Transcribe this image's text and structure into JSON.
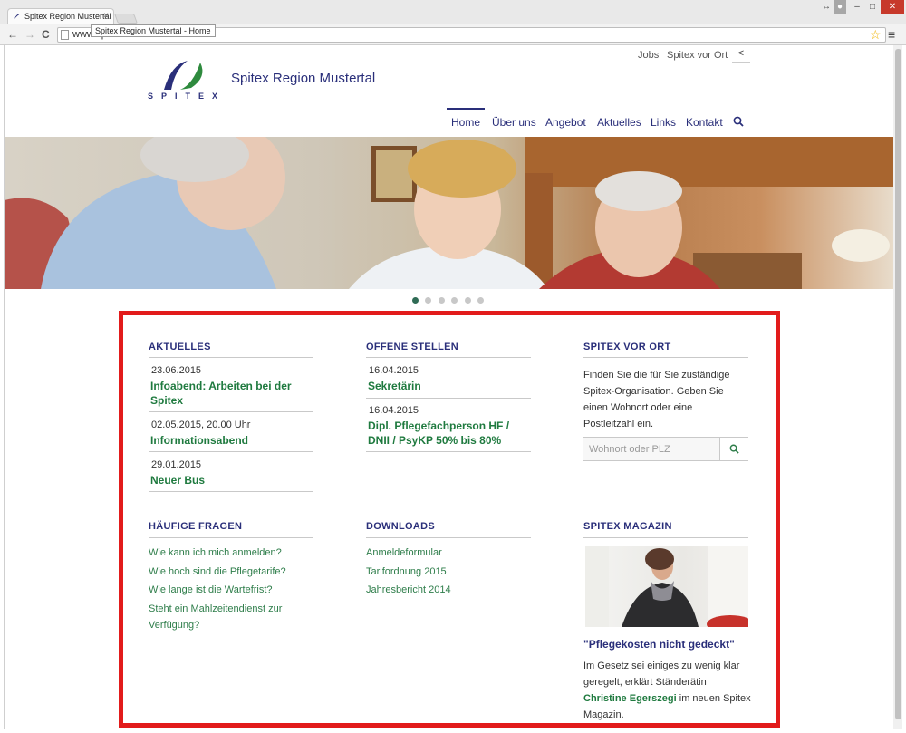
{
  "browser": {
    "tab_title": "Spitex Region Mustertal -",
    "tab_close": "×",
    "tooltip": "Spitex Region Mustertal - Home",
    "url": "www.spitex-website.ch",
    "back": "←",
    "forward": "→",
    "reload": "C",
    "star": "☆",
    "menu": "≡",
    "win_controls": [
      "↔",
      "–",
      "□",
      "✕"
    ]
  },
  "header": {
    "logo_text": "SPITEX",
    "site_title": "Spitex Region Mustertal",
    "top_links": [
      "Jobs",
      "Spitex vor Ort"
    ],
    "share_icon": "share-icon"
  },
  "nav": {
    "items": [
      "Home",
      "Über uns",
      "Angebot",
      "Aktuelles",
      "Links",
      "Kontakt"
    ],
    "active": "Home"
  },
  "carousel": {
    "count": 6,
    "active_index": 0
  },
  "aktuelles": {
    "title": "AKTUELLES",
    "items": [
      {
        "date": "23.06.2015",
        "title_lines": [
          "Infoabend: Arbeiten bei der",
          "Spitex"
        ]
      },
      {
        "date": "02.05.2015, 20.00 Uhr",
        "title_lines": [
          "Informationsabend"
        ]
      },
      {
        "date": "29.01.2015",
        "title_lines": [
          "Neuer Bus"
        ]
      }
    ]
  },
  "offene_stellen": {
    "title": "OFFENE STELLEN",
    "items": [
      {
        "date": "16.04.2015",
        "title_lines": [
          "Sekretärin"
        ]
      },
      {
        "date": "16.04.2015",
        "title_lines": [
          "Dipl. Pflegefachperson HF /",
          "DNII / PsyKP 50% bis 80%"
        ]
      }
    ]
  },
  "vor_ort": {
    "title": "SPITEX VOR ORT",
    "text_lines": [
      "Finden Sie die für Sie zuständige",
      "Spitex-Organisation. Geben Sie",
      "einen Wohnort oder eine",
      "Postleitzahl ein."
    ],
    "placeholder": "Wohnort oder PLZ"
  },
  "faq": {
    "title": "HÄUFIGE FRAGEN",
    "links": [
      "Wie kann ich mich anmelden?",
      "Wie hoch sind die Pflegetarife?",
      "Wie lange ist die Wartefrist?",
      "Steht ein Mahlzeitendienst zur",
      "Verfügung?"
    ]
  },
  "downloads": {
    "title": "DOWNLOADS",
    "links": [
      "Anmeldeformular",
      "Tarifordnung 2015",
      "Jahresbericht 2014"
    ]
  },
  "magazin": {
    "title": "SPITEX MAGAZIN",
    "headline": "\"Pflegekosten nicht gedeckt\"",
    "text_line1": "Im Gesetz sei einiges zu wenig klar",
    "text_line2": "geregelt, erklärt Ständerätin",
    "name": "Christine Egerszegi",
    "text_line3_rest": " im neuen Spitex",
    "text_line4": "Magazin."
  },
  "colors": {
    "brand_blue": "#2a2f7a",
    "link_green": "#1f7a3f",
    "highlight_red": "#e21b1b"
  }
}
